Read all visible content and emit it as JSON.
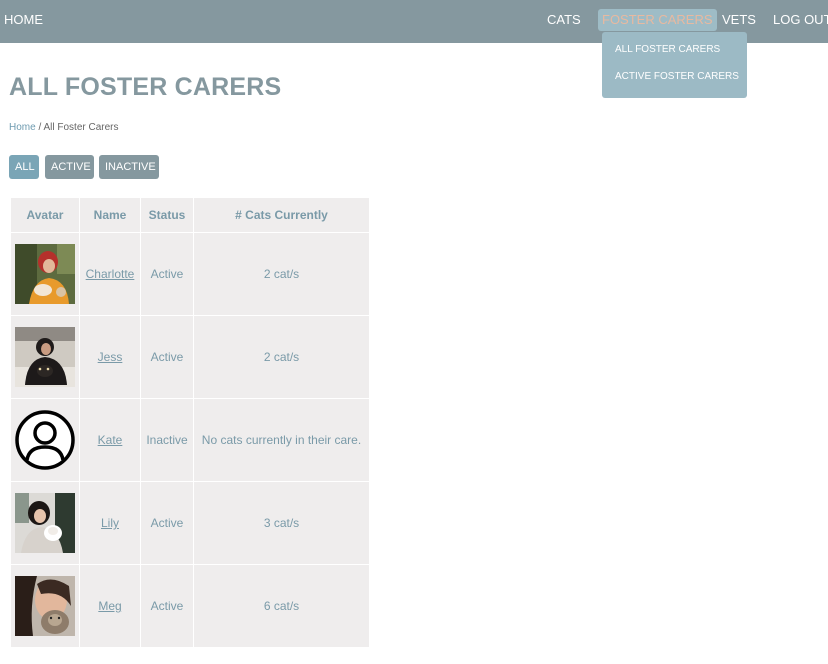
{
  "nav": {
    "home": "HOME",
    "cats": "CATS",
    "foster_carers": "FOSTER CARERS",
    "vets": "VETS",
    "logout": "LOG OUT"
  },
  "dropdown": {
    "all": "ALL FOSTER CARERS",
    "active": "ACTIVE FOSTER CARERS"
  },
  "page": {
    "title": "ALL FOSTER CARERS",
    "breadcrumb_home": "Home",
    "breadcrumb_sep": " / ",
    "breadcrumb_current": "All Foster Carers"
  },
  "filters": {
    "all": "ALL",
    "active": "ACTIVE",
    "inactive": "INACTIVE"
  },
  "table": {
    "headers": [
      "Avatar",
      "Name",
      "Status",
      "# Cats Currently"
    ],
    "rows": [
      {
        "name": "Charlotte",
        "status": "Active",
        "cats": "2 cat/s",
        "avatar": "photo-warm"
      },
      {
        "name": "Jess",
        "status": "Active",
        "cats": "2 cat/s",
        "avatar": "photo-dark"
      },
      {
        "name": "Kate",
        "status": "Inactive",
        "cats": "No cats currently in their care.",
        "avatar": "default-user-icon"
      },
      {
        "name": "Lily",
        "status": "Active",
        "cats": "3 cat/s",
        "avatar": "photo-light"
      },
      {
        "name": "Meg",
        "status": "Active",
        "cats": "6 cat/s",
        "avatar": "photo-cat"
      }
    ]
  },
  "colors": {
    "navbar": "#85989f",
    "accent": "#7aa5b6",
    "dropdown": "#9cbac5",
    "table_bg": "#efeded",
    "text": "#7a9aa8"
  }
}
